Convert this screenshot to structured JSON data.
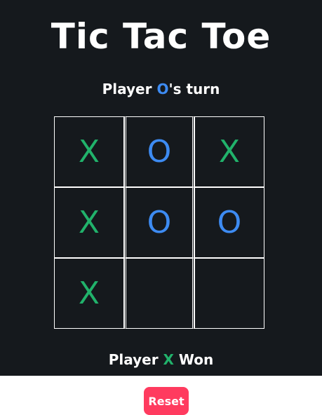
{
  "title": "Tic Tac Toe",
  "turn": {
    "prefix": "Player ",
    "mark": "O",
    "suffix": "'s turn"
  },
  "board": [
    [
      "X",
      "O",
      "X"
    ],
    [
      "X",
      "O",
      "O"
    ],
    [
      "X",
      "",
      ""
    ]
  ],
  "status": {
    "prefix": "Player ",
    "mark": "X",
    "suffix": " Won"
  },
  "reset_label": "Reset",
  "colors": {
    "x": "#21b26b",
    "o": "#3d8bf2",
    "background": "#15191d",
    "reset": "#ff3b5f"
  }
}
